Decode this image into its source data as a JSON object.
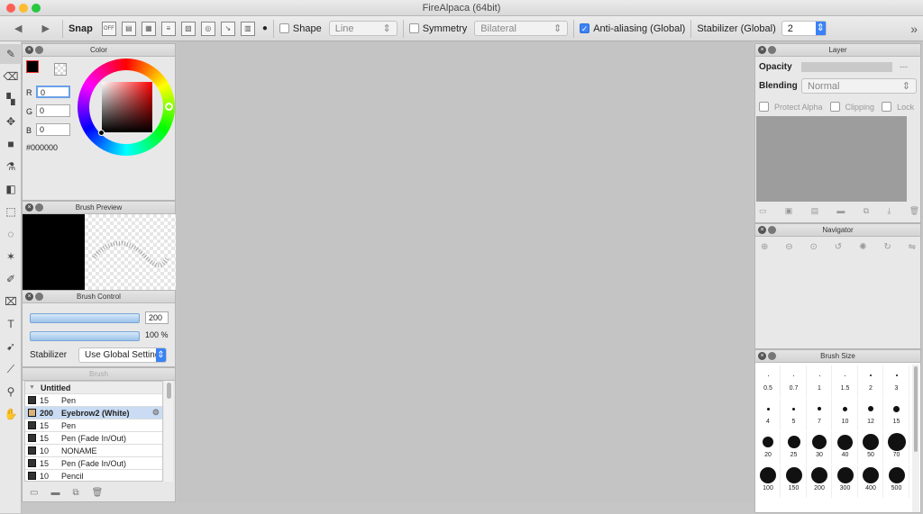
{
  "window": {
    "title": "FireAlpaca (64bit)"
  },
  "toolbar": {
    "snap_label": "Snap",
    "snap_off": "OFF",
    "shape_label": "Shape",
    "shape_value": "Line",
    "symmetry_label": "Symmetry",
    "symmetry_value": "Bilateral",
    "antialias_label": "Anti-aliasing (Global)",
    "stabilizer_label": "Stabilizer (Global)",
    "stabilizer_value": "2"
  },
  "color_panel": {
    "title": "Color",
    "r_label": "R",
    "r_value": "0",
    "g_label": "G",
    "g_value": "0",
    "b_label": "B",
    "b_value": "0",
    "hex": "#000000"
  },
  "brush_preview": {
    "title": "Brush Preview"
  },
  "brush_control": {
    "title": "Brush Control",
    "size_value": "200",
    "opacity_value": "100 %",
    "stabilizer_label": "Stabilizer",
    "stabilizer_value": "Use Global Setting"
  },
  "brush_panel": {
    "title": "Brush",
    "group": "Untitled",
    "items": [
      {
        "size": "15",
        "name": "Pen"
      },
      {
        "size": "200",
        "name": "Eyebrow2 (White)"
      },
      {
        "size": "15",
        "name": "Pen"
      },
      {
        "size": "15",
        "name": "Pen (Fade In/Out)"
      },
      {
        "size": "10",
        "name": "NONAME"
      },
      {
        "size": "15",
        "name": "Pen (Fade In/Out)"
      },
      {
        "size": "10",
        "name": "Pencil"
      }
    ]
  },
  "layer_panel": {
    "title": "Layer",
    "opacity_label": "Opacity",
    "opacity_value": "---",
    "blending_label": "Blending",
    "blending_value": "Normal",
    "protect_alpha": "Protect Alpha",
    "clipping": "Clipping",
    "lock": "Lock"
  },
  "navigator_panel": {
    "title": "Navigator"
  },
  "brush_size_panel": {
    "title": "Brush Size",
    "sizes": [
      "0.5",
      "0.7",
      "1",
      "1.5",
      "2",
      "3",
      "4",
      "5",
      "7",
      "10",
      "12",
      "15",
      "20",
      "25",
      "30",
      "40",
      "50",
      "70",
      "100",
      "150",
      "200",
      "300",
      "400",
      "500"
    ]
  }
}
